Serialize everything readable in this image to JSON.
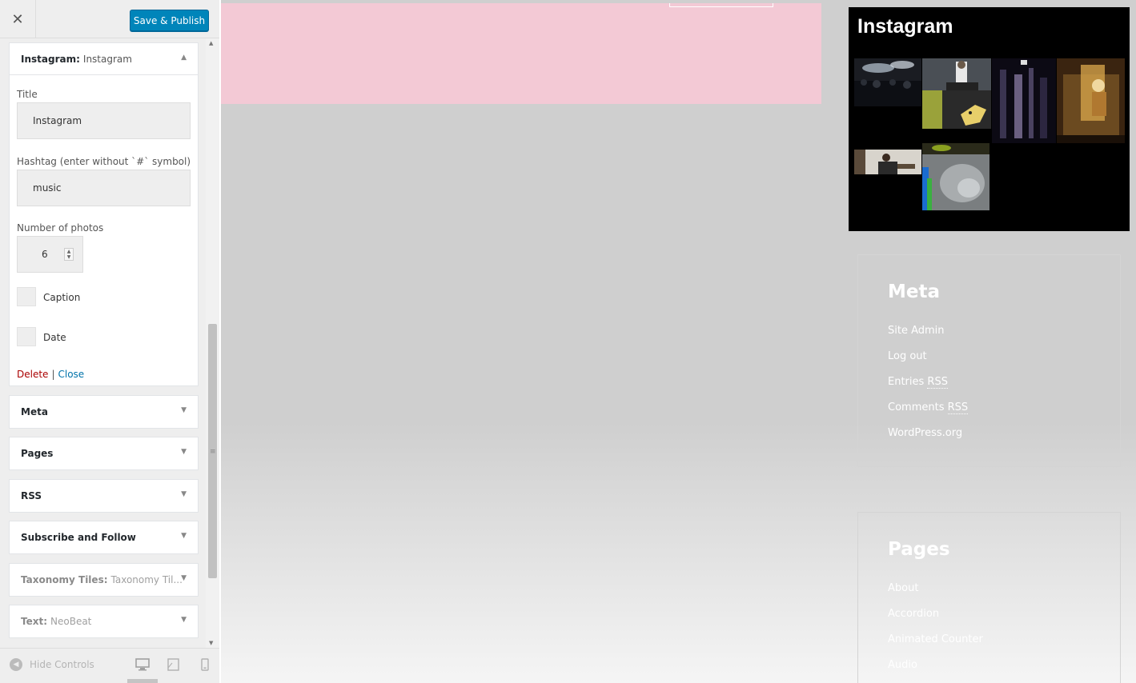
{
  "topbar": {
    "close_glyph": "✕",
    "publish_label": "Save & Publish"
  },
  "instagram_widget": {
    "type_label": "Instagram:",
    "name": "Instagram",
    "title_label": "Title",
    "title_value": "Instagram",
    "hashtag_label": "Hashtag (enter without `#` symbol)",
    "hashtag_value": "music",
    "photos_label": "Number of photos",
    "photos_value": "6",
    "caption_label": "Caption",
    "date_label": "Date",
    "delete_label": "Delete",
    "separator": "|",
    "close_label": "Close"
  },
  "widgets": [
    {
      "label": "Meta",
      "subtitle": ""
    },
    {
      "label": "Pages",
      "subtitle": ""
    },
    {
      "label": "RSS",
      "subtitle": ""
    },
    {
      "label": "Subscribe and Follow",
      "subtitle": ""
    },
    {
      "label": "Taxonomy Tiles:",
      "subtitle": "Taxonomy Til..."
    },
    {
      "label": "Text:",
      "subtitle": "NeoBeat"
    }
  ],
  "footer": {
    "hide_controls": "Hide Controls"
  },
  "preview": {
    "instagram_title": "Instagram",
    "meta": {
      "title": "Meta",
      "links": [
        "Site Admin",
        "Log out",
        "Entries",
        "Comments",
        "WordPress.org"
      ],
      "rss": "RSS"
    },
    "pages": {
      "title": "Pages",
      "links": [
        "About",
        "Accordion",
        "Animated Counter",
        "Audio"
      ]
    }
  },
  "icons": {
    "collapse": "arrow-up-icon",
    "expand": "arrow-down-icon",
    "desktop": "desktop-icon",
    "tablet": "tablet-icon",
    "mobile": "mobile-icon",
    "hide": "collapse-circle-icon"
  },
  "colors": {
    "primary": "#0085ba",
    "delete": "#aa0000",
    "link": "#0073aa",
    "hero": "#f3c9d5"
  }
}
